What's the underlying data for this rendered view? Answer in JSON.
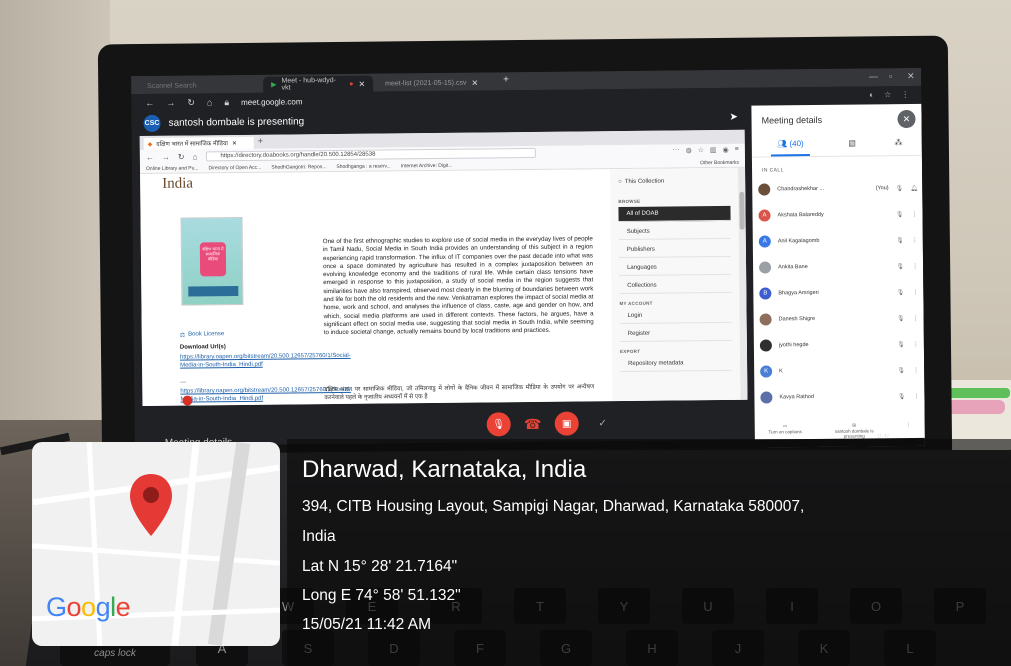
{
  "chrome": {
    "tabs": [
      {
        "label": "Scannel Search"
      },
      {
        "label": "Meet - hub-wdyd-vkt"
      },
      {
        "label": "meet-list (2021-05-15).csv"
      }
    ],
    "url": "meet.google.com"
  },
  "meet": {
    "presenter_initials": "CSC",
    "presenter_text": "santosh dombale is presenting",
    "meeting_details_label": "Meeting details",
    "details_panel": {
      "title": "Meeting details",
      "people_count": "(40)",
      "in_call_label": "IN CALL",
      "participants": [
        {
          "name": "Chandrashekhar ...",
          "you": "(You)",
          "initial": "",
          "color": "#6b4f3a"
        },
        {
          "name": "Akshata Balareddy",
          "initial": "A",
          "color": "#d9544a"
        },
        {
          "name": "Anil Kagalagomb",
          "initial": "A",
          "color": "#3b78e7"
        },
        {
          "name": "Ankita Bane",
          "initial": "",
          "color": "#9aa0a6"
        },
        {
          "name": "Bhagya Amrigeri",
          "initial": "B",
          "color": "#3c5ccf"
        },
        {
          "name": "Danesh Shigre",
          "initial": "",
          "color": "#8e6f5e"
        },
        {
          "name": "jyothi hegde",
          "initial": "",
          "color": "#2f2f2f"
        },
        {
          "name": "K",
          "initial": "K",
          "color": "#4a7fd6"
        },
        {
          "name": "Kavya Rathod",
          "initial": "",
          "color": "#5b6fa8"
        }
      ],
      "footer": {
        "captions": "Turn on captions",
        "presenting": "santosh dombale is presenting"
      }
    },
    "taskbar_time": "11:42"
  },
  "shared_page": {
    "ff_tab_label": "दक्षिण भारत में सामाजिक मीडिया",
    "url": "https://directory.doabooks.org/handle/20.500.12854/28538",
    "bookmarks": [
      "Online Library and Pu...",
      "Directory of Open Acc...",
      "ShodhGangotri: Repos...",
      "Shodhganga : a reserv...",
      "Internet Archive: Digit..."
    ],
    "bookmarks_other": "Other Bookmarks",
    "heading": "India",
    "book_cover_text": "दक्षिण भारत में सामाजिक मीडिया",
    "book_license": "Book License",
    "download_label": "Download Url(s)",
    "download_url_1": "https://library.oapen.org/bitstream/20.500.12657/25760/1/Social-Media-in-South-India_Hindi.pdf",
    "download_dash": "—",
    "download_url_2": "https://library.oapen.org/bitstream/20.500.12657/25760/1/Social-Media-in-South-India_Hindi.pdf",
    "abstract": "One of the first ethnographic studies to explore use of social media in the everyday lives of people in Tamil Nadu, Social Media in South India provides an understanding of this subject in a region experiencing rapid transformation. The influx of IT companies over the past decade into what was once a space dominated by agriculture has resulted in a complex juxtaposition between an evolving knowledge economy and the traditions of rural life. While certain class tensions have emerged in response to this juxtaposition, a study of social media in the region suggests that similarities have also transpired, observed most clearly in the blurring of boundaries between work and life for both the old residents and the new. Venkatraman explores the impact of social media at home, work and school, and analyses the influence of class, caste, age and gender on how, and which, social media platforms are used in different contexts. These factors, he argues, have a significant effect on social media use, suggesting that social media in South India, while seeming to induce societal change, actually remains bound by local traditions and practices.",
    "abstract_hindi": "दक्षिण भारत पर सामाजिक मीडिया, जो तमिलनाडु में लोगों के दैनिक जीवन में सामाजिक मीडिया के उपयोग पर अन्वेषण करनेवाले पहले के नृजातीय अध्ययनों में से एक है",
    "sidebar": {
      "this_collection": "This Collection",
      "browse_heading": "BROWSE",
      "browse_items": [
        "All of DOAB",
        "Subjects",
        "Publishers",
        "Languages",
        "Collections"
      ],
      "account_heading": "MY ACCOUNT",
      "account_items": [
        "Login",
        "Register"
      ],
      "export_heading": "EXPORT",
      "export_items": [
        "Repository metadata"
      ]
    }
  },
  "geotag": {
    "place": "Dharwad, Karnataka, India",
    "address": "394, CITB Housing Layout, Sampigi Nagar, Dharwad, Karnataka 580007,",
    "country": "India",
    "lat": "Lat N 15° 28' 21.7164\"",
    "long": "Long E 74° 58' 51.132\"",
    "datetime": "15/05/21 11:42 AM",
    "map_logo": "Google"
  },
  "keyboard": {
    "caps_label": "caps lock",
    "keys": [
      "A",
      "S",
      "D",
      "F",
      "G",
      "H",
      "J",
      "K",
      "L",
      "W",
      "E",
      "R",
      "T",
      "Y",
      "U",
      "I",
      "O",
      "P"
    ]
  },
  "colors": {
    "meet_dark": "#202124",
    "meet_red": "#ea4335",
    "meet_blue": "#1a73e8",
    "pin_red": "#e53935"
  }
}
